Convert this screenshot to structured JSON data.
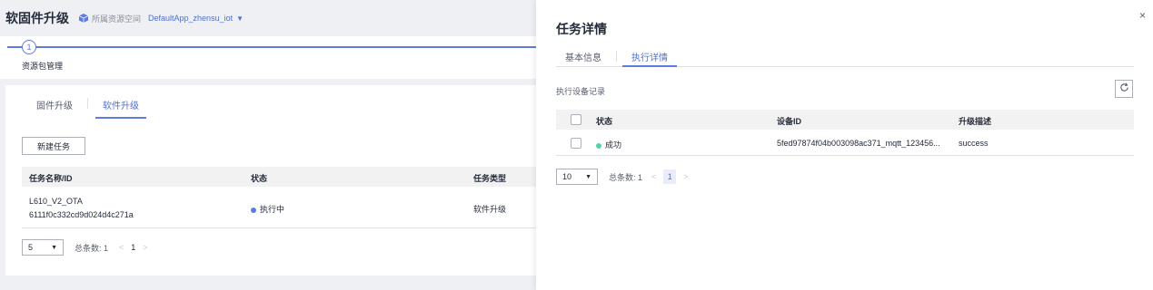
{
  "header": {
    "title": "软固件升级",
    "space_label": "所属资源空间",
    "space_name": "DefaultApp_zhensu_iot",
    "space_icon": "cube-icon"
  },
  "steps": {
    "current_number": "1",
    "label": "资源包管理"
  },
  "main": {
    "tabs": [
      {
        "label": "固件升级",
        "active": false
      },
      {
        "label": "软件升级",
        "active": true
      }
    ],
    "new_task_button": "新建任务",
    "table": {
      "columns": [
        "任务名称/ID",
        "状态",
        "任务类型"
      ],
      "rows": [
        {
          "name": "L610_V2_OTA",
          "id": "6111f0c332cd9d024d4c271a",
          "status": "执行中",
          "status_color": "#5e7ce0",
          "type": "软件升级"
        }
      ]
    },
    "pager": {
      "page_size": "5",
      "total": "总条数: 1",
      "prev": "<",
      "current": "1",
      "next": ">"
    }
  },
  "drawer": {
    "title": "任务详情",
    "close": "×",
    "tabs": [
      {
        "label": "基本信息",
        "active": false
      },
      {
        "label": "执行详情",
        "active": true
      }
    ],
    "section_label": "执行设备记录",
    "refresh_icon": "refresh-icon",
    "table": {
      "columns": [
        "状态",
        "设备ID",
        "升级描述"
      ],
      "rows": [
        {
          "status": "成功",
          "status_color": "#50d4ab",
          "device_id": "5fed97874f04b003098ac371_mqtt_123456...",
          "description": "success"
        }
      ]
    },
    "pager": {
      "page_size": "10",
      "total": "总条数: 1",
      "prev": "<",
      "current": "1",
      "next": ">"
    }
  }
}
